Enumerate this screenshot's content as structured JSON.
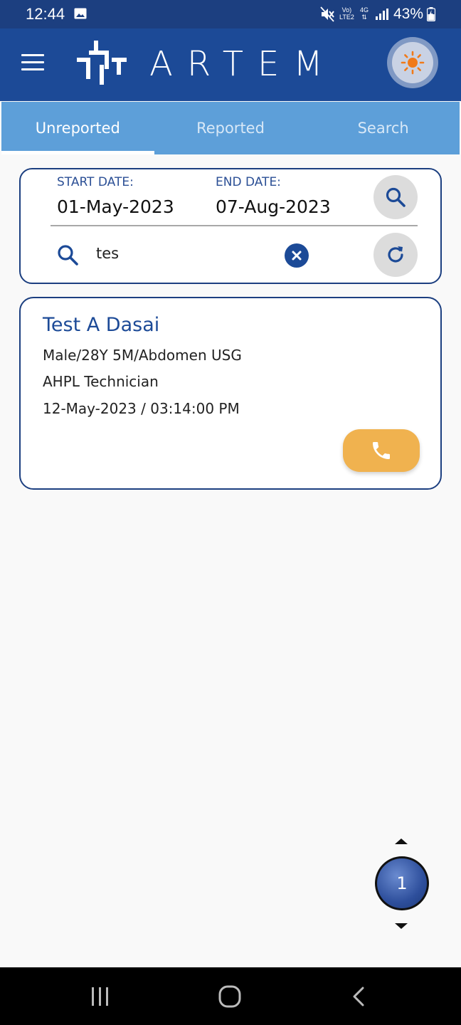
{
  "status_bar": {
    "time": "12:44",
    "volte_label_1": "Vo)",
    "volte_label_2": "LTE2",
    "network_type": "4G",
    "battery_percent": "43%",
    "icons": [
      "image-icon",
      "mute-icon",
      "signal-icon",
      "battery-icon"
    ]
  },
  "app_bar": {
    "brand": "ARTEM",
    "icons": [
      "menu-icon",
      "logo-mark",
      "sun-icon"
    ],
    "colors": {
      "bar": "#1c4a97",
      "sun": "#f07a1a"
    }
  },
  "tabs": [
    {
      "label": "Unreported",
      "active": true
    },
    {
      "label": "Reported",
      "active": false
    },
    {
      "label": "Search",
      "active": false
    }
  ],
  "filter": {
    "start_label": "START DATE:",
    "start_value": "01-May-2023",
    "end_label": "END DATE:",
    "end_value": "07-Aug-2023",
    "search_value": "tes",
    "icons": [
      "search-icon",
      "refresh-icon",
      "clear-icon"
    ]
  },
  "results": [
    {
      "name": "Test A Dasai",
      "study": "Male/28Y 5M/Abdomen USG",
      "technician": "AHPL Technician",
      "datetime": "12-May-2023 / 03:14:00 PM",
      "call_color": "#f0b24f"
    }
  ],
  "pagination": {
    "current_page": "1"
  },
  "nav_bar": {
    "icons": [
      "recent-apps-icon",
      "home-icon",
      "back-icon"
    ]
  }
}
